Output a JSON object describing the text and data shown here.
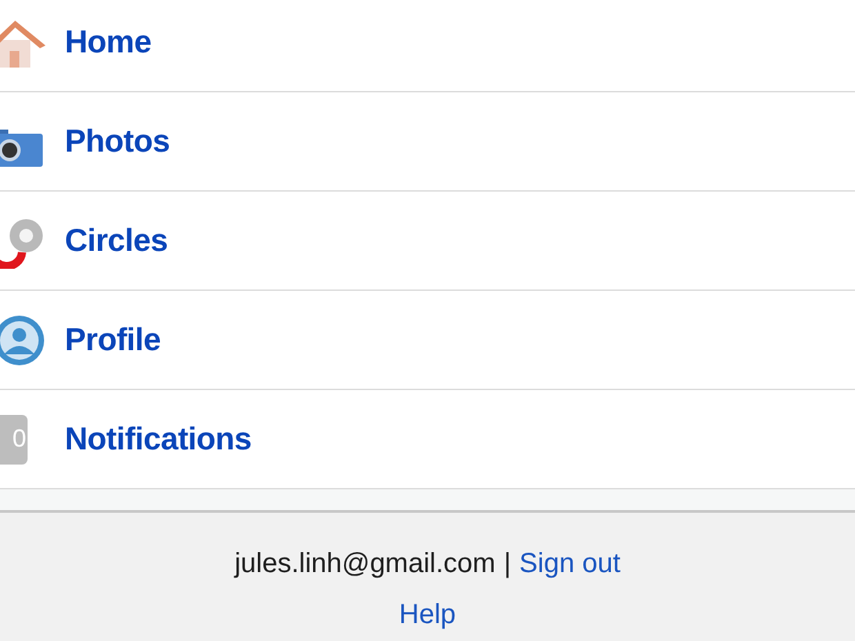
{
  "nav_items": [
    {
      "kind": "home",
      "label": "Home"
    },
    {
      "kind": "photos",
      "label": "Photos"
    },
    {
      "kind": "circles",
      "label": "Circles"
    },
    {
      "kind": "profile",
      "label": "Profile"
    },
    {
      "kind": "notifications",
      "label": "Notifications",
      "badge": "0"
    }
  ],
  "footer": {
    "email": "jules.linh@gmail.com",
    "separator": "|",
    "sign_out": "Sign out",
    "help": "Help"
  }
}
